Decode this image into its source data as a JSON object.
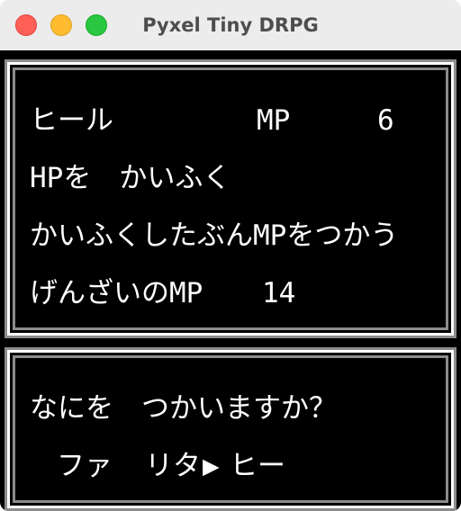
{
  "window": {
    "title": "Pyxel Tiny DRPG"
  },
  "spell_panel": {
    "name": "ヒール",
    "mp_label": "MP",
    "mp_cost": "6",
    "line2": "HPを　かいふく",
    "line3": "かいふくしたぶんMPをつかう",
    "line4_label": "げんざいのMP",
    "line4_value": "14"
  },
  "menu_panel": {
    "prompt": "なにを　つかいますか？",
    "options": [
      "ファ",
      "リタ",
      "ヒー"
    ],
    "cursor": "▶",
    "selected": "ヒー"
  }
}
